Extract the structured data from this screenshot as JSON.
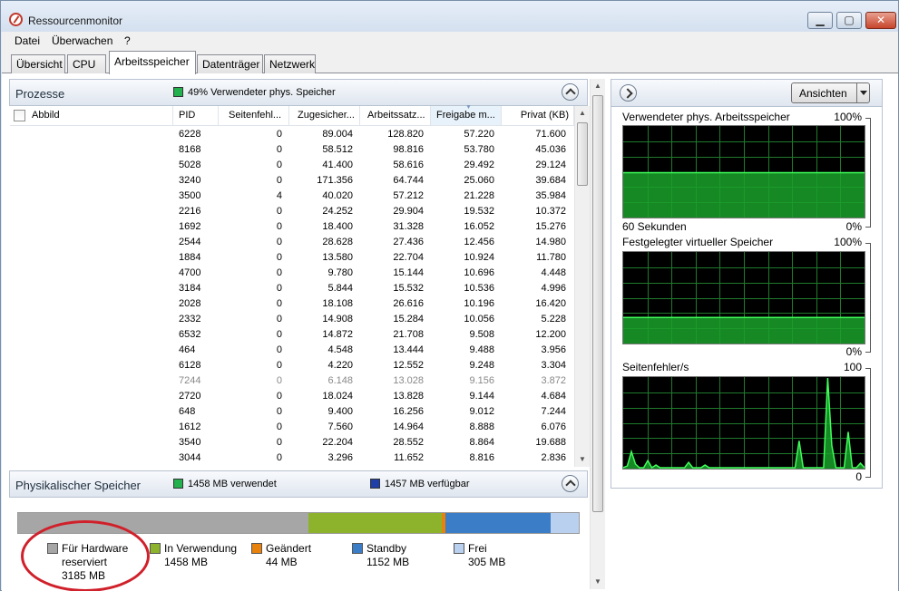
{
  "window": {
    "title": "Ressourcenmonitor",
    "controls": {
      "minimize": "▁",
      "maximize": "▢",
      "close": "✕"
    }
  },
  "menu": [
    "Datei",
    "Überwachen",
    "?"
  ],
  "tabs": [
    "Übersicht",
    "CPU",
    "Arbeitsspeicher",
    "Datenträger",
    "Netzwerk"
  ],
  "active_tab": "Arbeitsspeicher",
  "processes": {
    "title": "Prozesse",
    "stat_text": "49% Verwendeter phys. Speicher",
    "stat_color": "#22b14c",
    "columns": [
      "Abbild",
      "PID",
      "Seitenfehl...",
      "Zugesicher...",
      "Arbeitssatz...",
      "Freigabe m...",
      "Privat (KB)"
    ],
    "sorted_column": "Freigabe m...",
    "rows": [
      {
        "pid": "6228",
        "faults": "0",
        "commit": "89.004",
        "ws": "128.820",
        "share": "57.220",
        "priv": "71.600"
      },
      {
        "pid": "8168",
        "faults": "0",
        "commit": "58.512",
        "ws": "98.816",
        "share": "53.780",
        "priv": "45.036"
      },
      {
        "pid": "5028",
        "faults": "0",
        "commit": "41.400",
        "ws": "58.616",
        "share": "29.492",
        "priv": "29.124"
      },
      {
        "pid": "3240",
        "faults": "0",
        "commit": "171.356",
        "ws": "64.744",
        "share": "25.060",
        "priv": "39.684"
      },
      {
        "pid": "3500",
        "faults": "4",
        "commit": "40.020",
        "ws": "57.212",
        "share": "21.228",
        "priv": "35.984"
      },
      {
        "pid": "2216",
        "faults": "0",
        "commit": "24.252",
        "ws": "29.904",
        "share": "19.532",
        "priv": "10.372"
      },
      {
        "pid": "1692",
        "faults": "0",
        "commit": "18.400",
        "ws": "31.328",
        "share": "16.052",
        "priv": "15.276"
      },
      {
        "pid": "2544",
        "faults": "0",
        "commit": "28.628",
        "ws": "27.436",
        "share": "12.456",
        "priv": "14.980"
      },
      {
        "pid": "1884",
        "faults": "0",
        "commit": "13.580",
        "ws": "22.704",
        "share": "10.924",
        "priv": "11.780"
      },
      {
        "pid": "4700",
        "faults": "0",
        "commit": "9.780",
        "ws": "15.144",
        "share": "10.696",
        "priv": "4.448"
      },
      {
        "pid": "3184",
        "faults": "0",
        "commit": "5.844",
        "ws": "15.532",
        "share": "10.536",
        "priv": "4.996"
      },
      {
        "pid": "2028",
        "faults": "0",
        "commit": "18.108",
        "ws": "26.616",
        "share": "10.196",
        "priv": "16.420"
      },
      {
        "pid": "2332",
        "faults": "0",
        "commit": "14.908",
        "ws": "15.284",
        "share": "10.056",
        "priv": "5.228"
      },
      {
        "pid": "6532",
        "faults": "0",
        "commit": "14.872",
        "ws": "21.708",
        "share": "9.508",
        "priv": "12.200"
      },
      {
        "pid": "464",
        "faults": "0",
        "commit": "4.548",
        "ws": "13.444",
        "share": "9.488",
        "priv": "3.956"
      },
      {
        "pid": "6128",
        "faults": "0",
        "commit": "4.220",
        "ws": "12.552",
        "share": "9.248",
        "priv": "3.304"
      },
      {
        "pid": "7244",
        "faults": "0",
        "commit": "6.148",
        "ws": "13.028",
        "share": "9.156",
        "priv": "3.872",
        "dim": true
      },
      {
        "pid": "2720",
        "faults": "0",
        "commit": "18.024",
        "ws": "13.828",
        "share": "9.144",
        "priv": "4.684"
      },
      {
        "pid": "648",
        "faults": "0",
        "commit": "9.400",
        "ws": "16.256",
        "share": "9.012",
        "priv": "7.244"
      },
      {
        "pid": "1612",
        "faults": "0",
        "commit": "7.560",
        "ws": "14.964",
        "share": "8.888",
        "priv": "6.076"
      },
      {
        "pid": "3540",
        "faults": "0",
        "commit": "22.204",
        "ws": "28.552",
        "share": "8.864",
        "priv": "19.688"
      },
      {
        "pid": "3044",
        "faults": "0",
        "commit": "3.296",
        "ws": "11.652",
        "share": "8.816",
        "priv": "2.836"
      }
    ]
  },
  "physical": {
    "title": "Physikalischer Speicher",
    "used_text": "1458 MB verwendet",
    "used_color": "#22b14c",
    "avail_text": "1457 MB verfügbar",
    "avail_color": "#1f3fa8",
    "segments": [
      {
        "label": "Für Hardware reserviert",
        "value_text": "3185 MB",
        "mb": 3185,
        "color": "#a6a6a6"
      },
      {
        "label": "In Verwendung",
        "value_text": "1458 MB",
        "mb": 1458,
        "color": "#8db32c"
      },
      {
        "label": "Geändert",
        "value_text": "44 MB",
        "mb": 44,
        "color": "#e8820c"
      },
      {
        "label": "Standby",
        "value_text": "1152 MB",
        "mb": 1152,
        "color": "#3c7dc8"
      },
      {
        "label": "Frei",
        "value_text": "305 MB",
        "mb": 305,
        "color": "#b9d1ee"
      }
    ]
  },
  "right": {
    "button_label": "Ansichten",
    "graphs": [
      {
        "title": "Verwendeter phys. Arbeitsspeicher",
        "top_label": "100%",
        "bottom_left": "60 Sekunden",
        "bottom_right": "0%",
        "series_max": 100,
        "values": [
          49,
          49,
          49,
          49,
          49,
          49,
          49,
          49,
          49,
          49,
          49,
          49,
          49,
          49,
          49,
          49,
          49,
          49,
          49,
          49,
          49,
          49,
          49,
          49,
          49,
          49,
          49,
          49,
          49,
          49,
          49,
          49,
          49,
          49,
          49,
          49,
          49,
          49,
          49,
          49,
          49,
          49,
          49,
          49,
          49,
          49,
          49,
          49,
          49,
          49,
          49,
          49,
          49,
          49,
          49,
          49,
          49,
          49,
          49,
          49
        ]
      },
      {
        "title": "Festgelegter virtueller Speicher",
        "top_label": "100%",
        "bottom_left": "",
        "bottom_right": "0%",
        "series_max": 100,
        "values": [
          28,
          28,
          28,
          28,
          28,
          28,
          28,
          28,
          28,
          28,
          28,
          28,
          28,
          28,
          28,
          28,
          28,
          28,
          28,
          28,
          28,
          28,
          28,
          28,
          28,
          28,
          28,
          28,
          28,
          28,
          28,
          28,
          28,
          28,
          28,
          28,
          28,
          28,
          28,
          28,
          28,
          28,
          28,
          28,
          28,
          28,
          28,
          28,
          28,
          28,
          28,
          28,
          28,
          28,
          28,
          28,
          28,
          28,
          28,
          28
        ]
      },
      {
        "title": "Seitenfehler/s",
        "top_label": "100",
        "bottom_left": "",
        "bottom_right": "0",
        "series_max": 100,
        "values": [
          0,
          2,
          18,
          4,
          0,
          0,
          8,
          0,
          3,
          0,
          0,
          0,
          0,
          0,
          0,
          0,
          6,
          0,
          0,
          0,
          3,
          0,
          0,
          0,
          0,
          0,
          0,
          0,
          0,
          0,
          0,
          0,
          0,
          0,
          0,
          0,
          0,
          0,
          0,
          0,
          0,
          0,
          0,
          30,
          0,
          0,
          0,
          0,
          0,
          0,
          100,
          25,
          0,
          0,
          0,
          40,
          0,
          0,
          5,
          0
        ]
      }
    ]
  }
}
